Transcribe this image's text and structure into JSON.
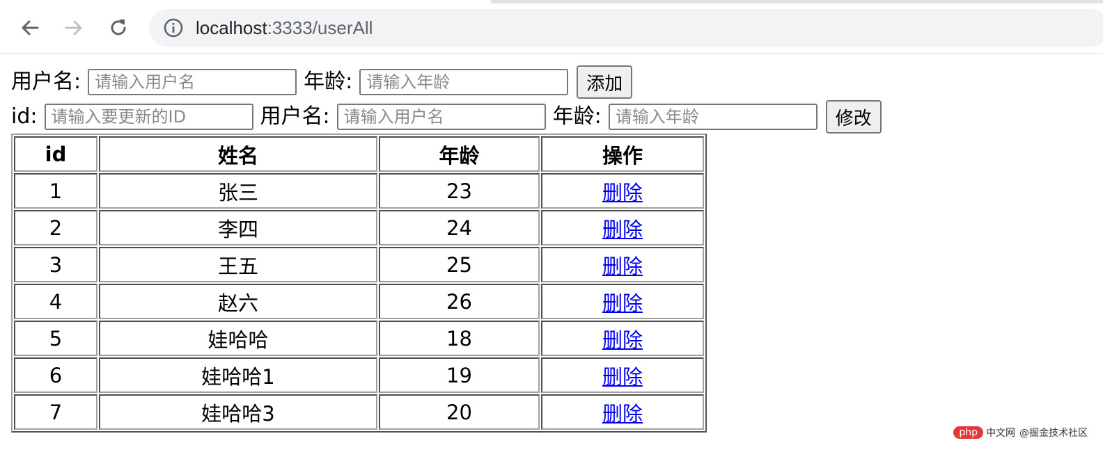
{
  "browser": {
    "url_host": "localhost",
    "url_rest": ":3333/userAll"
  },
  "icons": {
    "back": "back-arrow-icon",
    "forward": "forward-arrow-icon",
    "reload": "reload-icon",
    "site_info": "info-icon"
  },
  "add_form": {
    "username_label": "用户名:",
    "username_placeholder": "请输入用户名",
    "age_label": "年龄:",
    "age_placeholder": "请输入年龄",
    "add_button": "添加"
  },
  "update_form": {
    "id_label": "id:",
    "id_placeholder": "请输入要更新的ID",
    "username_label": "用户名:",
    "username_placeholder": "请输入用户名",
    "age_label": "年龄:",
    "age_placeholder": "请输入年龄",
    "update_button": "修改"
  },
  "table": {
    "headers": [
      "id",
      "姓名",
      "年龄",
      "操作"
    ],
    "rows": [
      {
        "id": "1",
        "name": "张三",
        "age": "23",
        "action": "删除"
      },
      {
        "id": "2",
        "name": "李四",
        "age": "24",
        "action": "删除"
      },
      {
        "id": "3",
        "name": "王五",
        "age": "25",
        "action": "删除"
      },
      {
        "id": "4",
        "name": "赵六",
        "age": "26",
        "action": "删除"
      },
      {
        "id": "5",
        "name": "娃哈哈",
        "age": "18",
        "action": "删除"
      },
      {
        "id": "6",
        "name": "娃哈哈1",
        "age": "19",
        "action": "删除"
      },
      {
        "id": "7",
        "name": "娃哈哈3",
        "age": "20",
        "action": "删除"
      }
    ]
  },
  "watermark": {
    "badge": "php",
    "site": "中文网",
    "credit": "@掘金技术社区"
  }
}
